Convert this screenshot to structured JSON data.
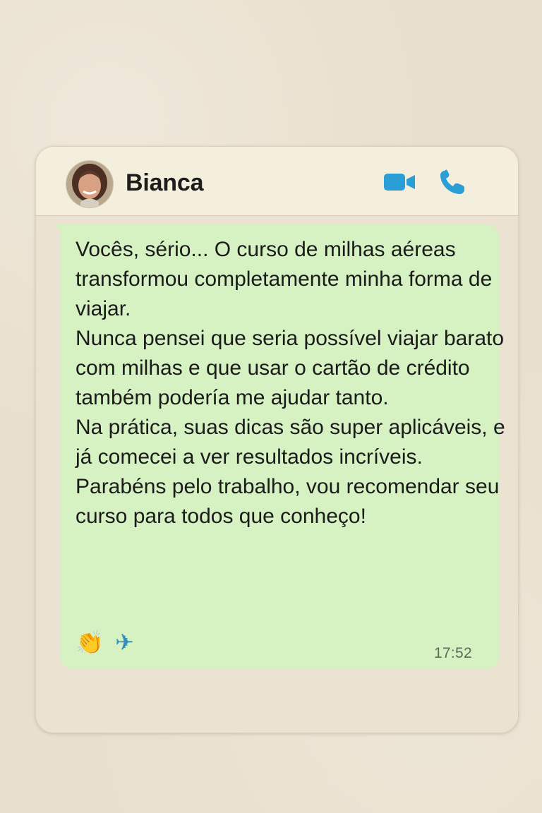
{
  "chat": {
    "contact_name": "Bianca",
    "icons": {
      "avatar": "avatar",
      "video": "video-call-icon",
      "phone": "phone-call-icon"
    },
    "colors": {
      "accent": "#2a9fd6",
      "bubble": "#d6f2c2",
      "header": "#f3efdc",
      "background": "#e9dfcd"
    }
  },
  "message": {
    "paragraphs": [
      "Vocês, sério... O curso de milhas aéreas transformou completamente minha forma de viajar.",
      "Nunca pensei que seria possível viajar barato com milhas e que usar o cartão de crédito também podería me ajudar tanto.",
      "Na prática, suas dicas são super aplicáveis, e já comecei a ver resultados incríveis.",
      "Parabéns pelo trabalho, vou recomendar seu curso para todos que conheço!"
    ],
    "emojis": [
      "👏",
      "✈"
    ],
    "time": "17:52"
  }
}
